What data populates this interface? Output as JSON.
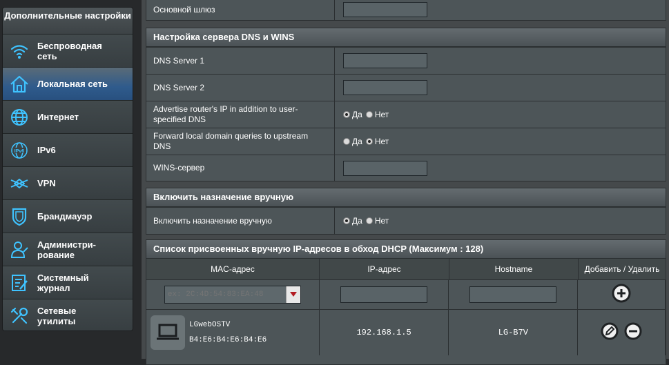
{
  "sidebar": {
    "title": "Дополнительные настройки",
    "items": [
      {
        "label": "Беспроводная сеть",
        "icon": "wifi-icon"
      },
      {
        "label": "Локальная сеть",
        "icon": "home-icon",
        "active": true
      },
      {
        "label": "Интернет",
        "icon": "globe-icon"
      },
      {
        "label": "IPv6",
        "icon": "ipv6-globe-icon"
      },
      {
        "label": "VPN",
        "icon": "vpn-icon"
      },
      {
        "label": "Брандмауэр",
        "icon": "shield-icon"
      },
      {
        "label": "Администри-рование",
        "icon": "admin-user-icon"
      },
      {
        "label": "Системный журнал",
        "icon": "log-icon"
      },
      {
        "label": "Сетевые утилиты",
        "icon": "tools-icon"
      }
    ]
  },
  "gateway": {
    "label": "Основной шлюз",
    "value": ""
  },
  "dns": {
    "title": "Настройка сервера DNS и WINS",
    "dns1_label": "DNS Server 1",
    "dns2_label": "DNS Server 2",
    "advertise_label": "Advertise router's IP in addition to user-specified DNS",
    "forward_label": "Forward local domain queries to upstream DNS",
    "wins_label": "WINS-сервер",
    "yes": "Да",
    "no": "Нет"
  },
  "manual": {
    "title": "Включить назначение вручную",
    "label": "Включить назначение вручную",
    "yes": "Да",
    "no": "Нет"
  },
  "list": {
    "title": "Список присвоенных вручную IP-адресов в обход DHCP (Максимум : 128)",
    "col_mac": "MAC-адрес",
    "col_ip": "IP-адрес",
    "col_host": "Hostname",
    "col_action": "Добавить / Удалить",
    "mac_placeholder": "ex: 2C:4D:54:83:EA:48",
    "rows": [
      {
        "name": "LGwebOSTV",
        "mac": "B4:E6:B4:E6:B4:E6",
        "ip": "192.168.1.5",
        "hostname": "LG-B7V"
      }
    ]
  },
  "colors": {
    "accent": "#2f5b8c",
    "panel": "#4d5558"
  }
}
